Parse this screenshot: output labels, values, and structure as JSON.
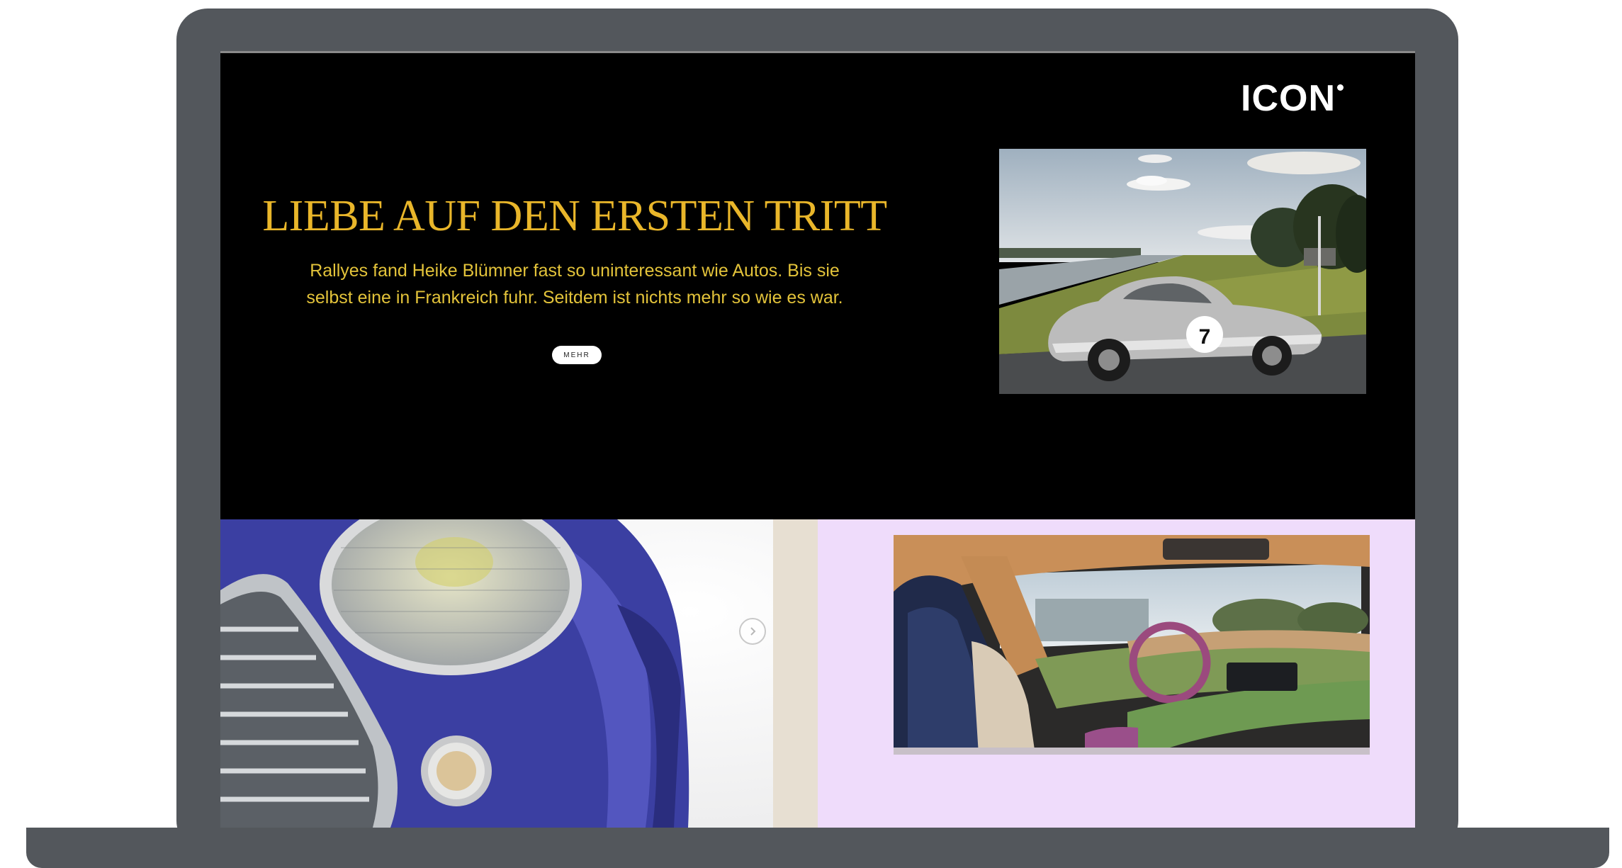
{
  "site": {
    "logo": "ICON"
  },
  "hero": {
    "headline": "LIEBE AUF DEN ERSTEN TRITT",
    "teaser_line1": "Rallyes fand Heike Blümner fast so uninteressant wie Autos. Bis sie",
    "teaser_line2": "selbst eine in Frankreich fuhr. Seitdem ist nichts mehr so wie es war.",
    "more_label": "MEHR",
    "photo_car_number": "7"
  },
  "colors": {
    "headline": "#e9b62a",
    "hero_bg": "#000000",
    "right_tile_bg": "#efdcfb",
    "device": "#53575c"
  },
  "icons": {
    "slider_next": "chevron-right-icon",
    "logo_dot": "dot-icon"
  }
}
